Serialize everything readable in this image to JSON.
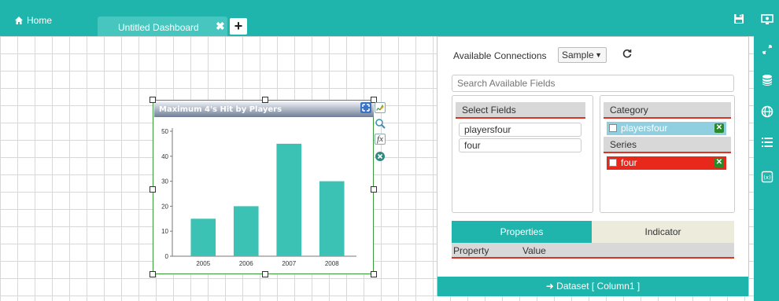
{
  "colors": {
    "accent": "#1fb5ac",
    "bar": "#3cc1b5",
    "category_chip": "#8fcfe0",
    "series_chip": "#e8281b",
    "underline": "#d32f2f"
  },
  "topbar": {
    "home_label": "Home",
    "home_icon": "home-icon",
    "tab_label": "Untitled Dashboard",
    "tab_close": "✖",
    "add_tab": "+",
    "save_icon": "save-icon"
  },
  "rail": {
    "icons": [
      "monitor-icon",
      "expand-icon",
      "database-icon",
      "globe-icon",
      "list-icon",
      "variable-icon"
    ]
  },
  "widget": {
    "title": "Maximum 4's Hit by Players",
    "tools": [
      "maximize-icon",
      "edit-chart-icon",
      "zoom-icon",
      "function-icon",
      "close-icon"
    ],
    "function_glyph": "fx"
  },
  "chart_data": {
    "type": "bar",
    "title": "Maximum 4's Hit by Players",
    "categories": [
      "2005",
      "2006",
      "2007",
      "2008"
    ],
    "values": [
      15,
      20,
      45,
      30
    ],
    "yticks": [
      0,
      10,
      20,
      30,
      40,
      50
    ],
    "ylim": [
      0,
      50
    ],
    "grid": false,
    "legend": "none"
  },
  "panel": {
    "connections_label": "Available Connections",
    "connection_selected": "Sample",
    "search_placeholder": "Search Available Fields",
    "select_fields_label": "Select Fields",
    "fields": [
      "playersfour",
      "four"
    ],
    "category_label": "Category",
    "category_item": "playersfour",
    "series_label": "Series",
    "series_item": "four",
    "tabs": {
      "properties": "Properties",
      "indicator": "Indicator"
    },
    "property_col": "Property",
    "value_col": "Value",
    "dataset_label": "➜ Dataset [ Column1 ]"
  }
}
